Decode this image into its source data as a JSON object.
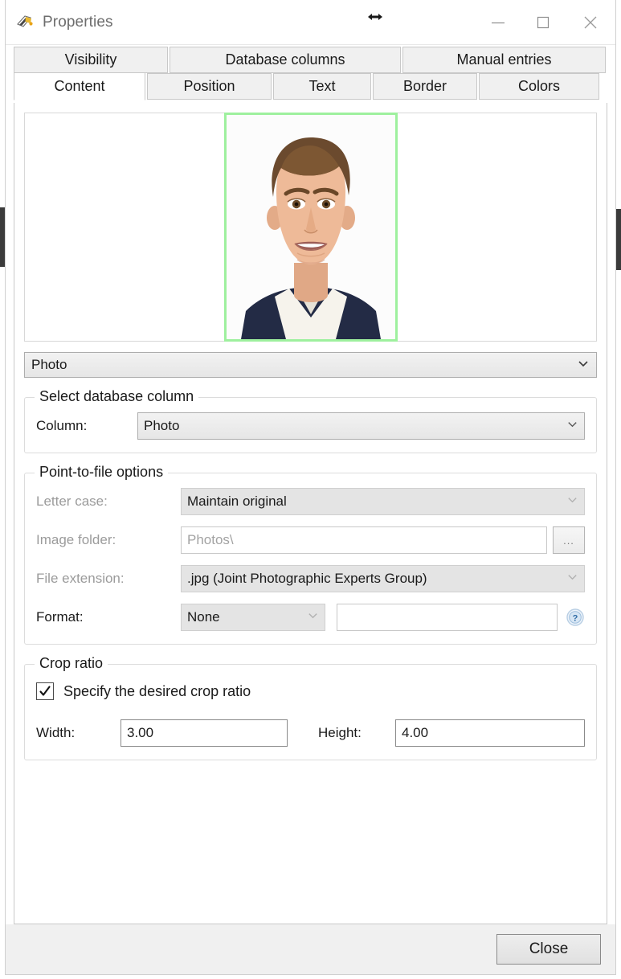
{
  "window": {
    "title": "Properties",
    "app_icon": "app-logo-icon",
    "controls": {
      "resize_cursor": "horizontal-resize-cursor",
      "minimize": "minimize-icon",
      "maximize": "maximize-icon",
      "close": "close-icon"
    }
  },
  "tabs": {
    "top_row": [
      {
        "label": "Visibility",
        "selected": false
      },
      {
        "label": "Database columns",
        "selected": false
      },
      {
        "label": "Manual entries",
        "selected": false
      }
    ],
    "bottom_row": [
      {
        "label": "Content",
        "selected": true
      },
      {
        "label": "Position",
        "selected": false
      },
      {
        "label": "Text",
        "selected": false
      },
      {
        "label": "Border",
        "selected": false
      },
      {
        "label": "Colors",
        "selected": false
      }
    ]
  },
  "content_tab": {
    "preview": {
      "name": "photo-preview",
      "alt": "portrait-photo",
      "highlight_color": "#9ef09e"
    },
    "content_type": {
      "value": "Photo",
      "caret": "chevron-down-icon"
    },
    "select_database_column": {
      "title": "Select database column",
      "column_label": "Column:",
      "column_value": "Photo"
    },
    "point_to_file_options": {
      "title": "Point-to-file options",
      "letter_case_label": "Letter case:",
      "letter_case_value": "Maintain original",
      "image_folder_label": "Image folder:",
      "image_folder_placeholder": "Photos\\",
      "image_folder_value": "",
      "browse_label": "...",
      "file_extension_label": "File extension:",
      "file_extension_value": ".jpg (Joint Photographic Experts Group)",
      "format_label": "Format:",
      "format_value": "None",
      "format_text_value": "",
      "help_icon": "help-icon"
    },
    "crop_ratio": {
      "title": "Crop ratio",
      "checkbox_label": "Specify the desired crop ratio",
      "checkbox_checked": true,
      "width_label": "Width:",
      "width_value": "3.00",
      "height_label": "Height:",
      "height_value": "4.00"
    }
  },
  "footer": {
    "close_label": "Close"
  }
}
